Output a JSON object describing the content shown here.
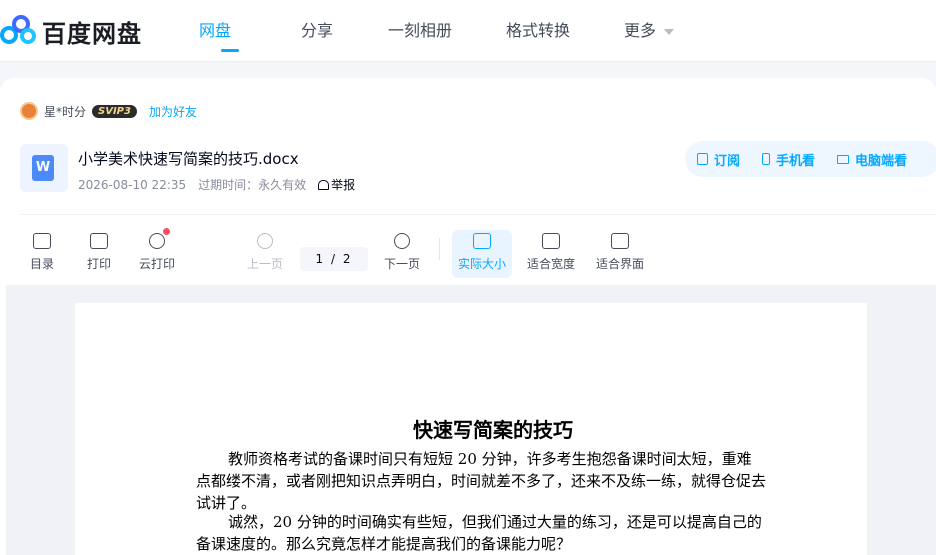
{
  "brand": {
    "name": "百度网盘"
  },
  "nav": {
    "items": [
      "网盘",
      "分享",
      "一刻相册",
      "格式转换"
    ],
    "more_label": "更多",
    "active_index": 0
  },
  "owner": {
    "name": "星*时分",
    "badge": "SVIP3",
    "add_friend": "加为好友"
  },
  "file": {
    "name": "小学美术快速写简案的技巧.docx",
    "date": "2026-08-10 22:35",
    "expiry": "过期时间：永久有效",
    "report": "举报",
    "icon_letter": "W"
  },
  "actions": {
    "subscribe": "订阅",
    "phone_view": "手机看",
    "pc_view": "电脑端看"
  },
  "toolbar": {
    "catalog": "目录",
    "print": "打印",
    "cloud_print": "云打印",
    "prev_page": "上一页",
    "page_indicator": "1 / 2",
    "next_page": "下一页",
    "actual_size": "实际大小",
    "fit_width": "适合宽度",
    "fit_screen": "适合界面"
  },
  "document": {
    "title": "快速写简案的技巧",
    "paragraph1": "教师资格考试的备课时间只有短短 20 分钟，许多考生抱怨备课时间太短，重难点都缕不清，或者刚把知识点弄明白，时间就差不多了，还来不及练一练，就得仓促去试讲了。",
    "paragraph2": "诚然，20 分钟的时间确实有些短，但我们通过大量的练习，还是可以提高自己的备课速度的。那么究竟怎样才能提高我们的备课能力呢？"
  },
  "colors": {
    "accent": "#06a7ff",
    "text": "#03081a",
    "muted": "#878c9c"
  }
}
